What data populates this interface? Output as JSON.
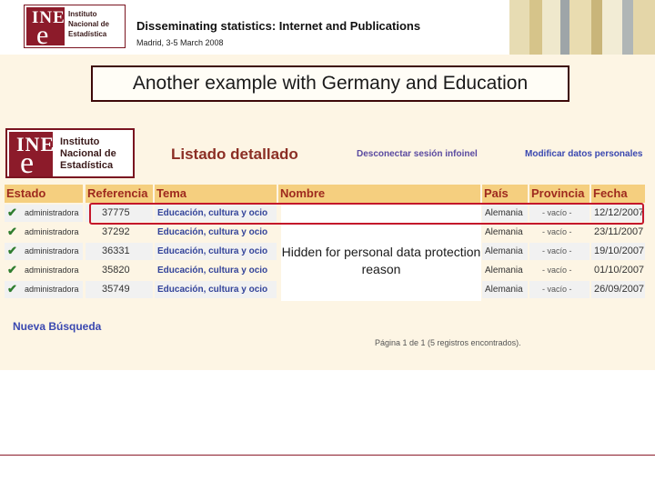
{
  "header": {
    "logo": {
      "mark_top": "INE",
      "mark_bottom": "e",
      "text": "Instituto Nacional de Estadística"
    },
    "title": "Disseminating statistics: Internet and Publications",
    "date": "Madrid, 3-5 March 2008"
  },
  "caption": "Another example with Germany and Education",
  "screenshot": {
    "logo": {
      "mark_top": "INE",
      "mark_bottom": "e",
      "text": "Instituto Nacional de Estadística"
    },
    "page_title": "Listado detallado",
    "disconnect_link": "Desconectar sesión infoinel",
    "modify_link": "Modificar datos personales",
    "columns": [
      "Estado",
      "Referencia",
      "Tema",
      "Nombre",
      "País",
      "Provincia",
      "Fecha"
    ],
    "rows": [
      {
        "estado": "administradora",
        "ref": "37775",
        "tema": "Educación, cultura y ocio",
        "pais": "Alemania",
        "provincia": "- vacío -",
        "fecha": "12/12/2007"
      },
      {
        "estado": "administradora",
        "ref": "37292",
        "tema": "Educación, cultura y ocio",
        "pais": "Alemania",
        "provincia": "- vacío -",
        "fecha": "23/11/2007"
      },
      {
        "estado": "administradora",
        "ref": "36331",
        "tema": "Educación, cultura y ocio",
        "pais": "Alemania",
        "provincia": "- vacío -",
        "fecha": "19/10/2007"
      },
      {
        "estado": "administradora",
        "ref": "35820",
        "tema": "Educación, cultura y ocio",
        "pais": "Alemania",
        "provincia": "- vacío -",
        "fecha": "01/10/2007"
      },
      {
        "estado": "administradora",
        "ref": "35749",
        "tema": "Educación, cultura y ocio",
        "pais": "Alemania",
        "provincia": "- vacío -",
        "fecha": "26/09/2007"
      }
    ],
    "privacy_note": "Hidden for personal data protection reason",
    "new_search": "Nueva Búsqueda",
    "pagination": "Página 1 de 1 (5 registros encontrados)."
  },
  "icons": {
    "check": "check-icon"
  },
  "colors": {
    "brand": "#8c1b2a",
    "header_bg": "#f5cf7f",
    "highlight": "#c4172a"
  }
}
